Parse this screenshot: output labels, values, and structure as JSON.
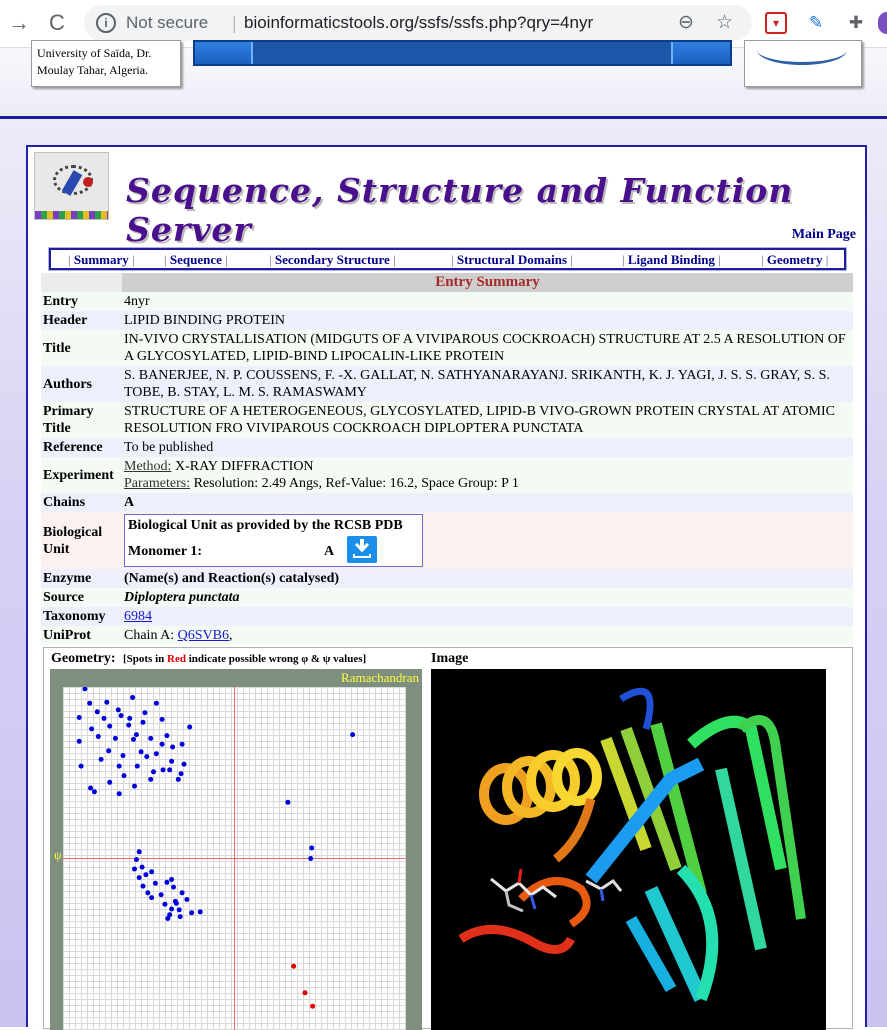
{
  "browser": {
    "security_label": "Not secure",
    "url": "bioinformaticstools.org/ssfs/ssfs.php?qry=4nyr"
  },
  "header": {
    "university": "University of Saïda, Dr. Moulay Tahar, Algeria."
  },
  "site": {
    "title": "Sequence, Structure and Function Server",
    "main_page_link": "Main Page"
  },
  "tabs": [
    {
      "label": "Summary"
    },
    {
      "label": "Sequence"
    },
    {
      "label": "Secondary Structure"
    },
    {
      "label": "Structural Domains"
    },
    {
      "label": "Ligand Binding"
    },
    {
      "label": "Geometry"
    }
  ],
  "summary": {
    "heading": "Entry Summary",
    "entry": {
      "label": "Entry",
      "value": "4nyr"
    },
    "header": {
      "label": "Header",
      "value": "LIPID BINDING PROTEIN"
    },
    "title": {
      "label": "Title",
      "value": "IN-VIVO CRYSTALLISATION (MIDGUTS OF A VIVIPAROUS COCKROACH) STRUCTURE AT 2.5 A RESOLUTION OF A GLYCOSYLATED, LIPID-BIND LIPOCALIN-LIKE PROTEIN"
    },
    "authors": {
      "label": "Authors",
      "value": "S. BANERJEE, N. P. COUSSENS, F. -X. GALLAT, N. SATHYANARAYANJ. SRIKANTH, K. J. YAGI, J. S. S. GRAY, S. S. TOBE, B. STAY, L. M. S. RAMASWAMY"
    },
    "primary_title": {
      "label": "Primary Title",
      "value": "STRUCTURE OF A HETEROGENEOUS, GLYCOSYLATED, LIPID-B VIVO-GROWN PROTEIN CRYSTAL AT ATOMIC RESOLUTION FRO VIVIPAROUS COCKROACH DIPLOPTERA PUNCTATA"
    },
    "reference": {
      "label": "Reference",
      "value": "To be published"
    },
    "experiment": {
      "label": "Experiment",
      "method_label": "Method:",
      "method": "X-RAY DIFFRACTION",
      "params_label": "Parameters:",
      "params": "Resolution: 2.49 Angs, Ref-Value: 16.2, Space Group: P 1"
    },
    "chains": {
      "label": "Chains",
      "value": "A"
    },
    "bio_unit": {
      "label": "Biological Unit",
      "box_title": "Biological Unit as provided by the RCSB PDB",
      "monomer_label": "Monomer 1:",
      "monomer_chain": "A"
    },
    "enzyme": {
      "label": "Enzyme",
      "value": "(Name(s) and Reaction(s) catalysed)"
    },
    "source": {
      "label": "Source",
      "value": "Diploptera punctata"
    },
    "taxonomy": {
      "label": "Taxonomy",
      "value": "6984"
    },
    "uniprot": {
      "label": "UniProt",
      "prefix": "Chain A:",
      "link": "Q6SVB6",
      "suffix": ","
    }
  },
  "geometry": {
    "label": "Geometry:",
    "note_open": "[Spots in",
    "note_red": "Red",
    "note_close": "indicate possible wrong φ & ψ values]",
    "plot_title": "Ramachandran",
    "psi_label": "ψ",
    "image_label": "Image"
  },
  "colors": {
    "panel_border": "#2020a8",
    "link": "#00008b",
    "heading_red": "#a52a2a",
    "dot_blue": "#0000dd",
    "dot_red": "#e00000"
  },
  "chart_data": {
    "type": "scatter",
    "title": "Ramachandran",
    "xlabel": "",
    "ylabel": "ψ",
    "xlim": [
      -180,
      180
    ],
    "ylim": [
      -180,
      180
    ],
    "grid": true,
    "series": [
      {
        "points": [
          [
            -157,
            178
          ],
          [
            -134,
            164
          ],
          [
            -107,
            169
          ],
          [
            -144,
            154
          ],
          [
            -122,
            156
          ],
          [
            -119,
            150
          ],
          [
            -94,
            153
          ],
          [
            -82,
            163
          ],
          [
            -163,
            148
          ],
          [
            -150,
            136
          ],
          [
            -131,
            139
          ],
          [
            -111,
            140
          ],
          [
            -96,
            143
          ],
          [
            -76,
            146
          ],
          [
            -143,
            128
          ],
          [
            -125,
            126
          ],
          [
            -106,
            125
          ],
          [
            -88,
            126
          ],
          [
            -71,
            129
          ],
          [
            -132,
            113
          ],
          [
            -117,
            108
          ],
          [
            -98,
            112
          ],
          [
            -82,
            110
          ],
          [
            -65,
            117
          ],
          [
            -102,
            97
          ],
          [
            -85,
            91
          ],
          [
            -140,
            104
          ],
          [
            -161,
            97
          ],
          [
            -116,
            87
          ],
          [
            -88,
            83
          ],
          [
            -151,
            74
          ],
          [
            -121,
            68
          ],
          [
            -66,
            102
          ],
          [
            -75,
            93
          ],
          [
            -53,
            99
          ],
          [
            -68,
            93
          ],
          [
            -56,
            89
          ],
          [
            -105,
            76
          ],
          [
            -47,
            138
          ],
          [
            -55,
            120
          ],
          [
            -59,
            83
          ],
          [
            -76,
            120
          ],
          [
            -110,
            147
          ],
          [
            -103,
            130
          ],
          [
            -152,
            163
          ],
          [
            -137,
            147
          ],
          [
            -163,
            123
          ],
          [
            -92,
            107
          ],
          [
            -121,
            97
          ],
          [
            -131,
            80
          ],
          [
            -147,
            70
          ],
          [
            -103,
            -1
          ],
          [
            -97,
            -9
          ],
          [
            -87,
            -14
          ],
          [
            -105,
            -11
          ],
          [
            -100,
            -20
          ],
          [
            -96,
            -29
          ],
          [
            -83,
            -26
          ],
          [
            -91,
            -36
          ],
          [
            -77,
            -38
          ],
          [
            -66,
            -22
          ],
          [
            -71,
            -25
          ],
          [
            -64,
            -30
          ],
          [
            -61,
            -47
          ],
          [
            -66,
            -53
          ],
          [
            -58,
            -54
          ],
          [
            -68,
            -59
          ],
          [
            -62,
            -45
          ],
          [
            -50,
            -43
          ],
          [
            -36,
            -56
          ],
          [
            -57,
            -61
          ],
          [
            -70,
            -63
          ],
          [
            -45,
            -57
          ],
          [
            -100,
            7
          ],
          [
            -87,
            -41
          ],
          [
            -55,
            -36
          ],
          [
            -73,
            -48
          ],
          [
            -93,
            -17
          ],
          [
            124,
            130
          ],
          [
            56,
            59
          ],
          [
            81,
            11
          ],
          [
            80,
            0
          ]
        ]
      },
      {
        "name": "possible wrong φ & ψ values",
        "points": [
          [
            62,
            -113
          ],
          [
            74,
            -141
          ],
          [
            82,
            -155
          ]
        ]
      }
    ]
  }
}
